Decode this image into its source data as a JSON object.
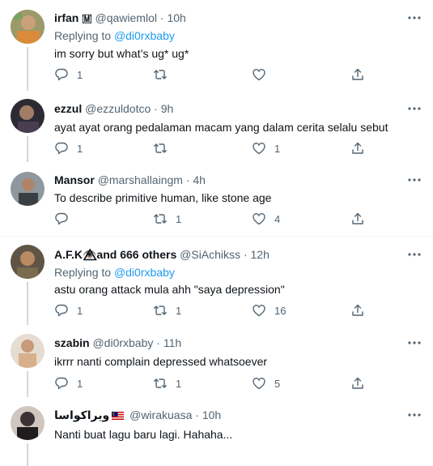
{
  "tweets": [
    {
      "name": "irfan 🇲",
      "handle": "@qawiemlol",
      "sep": "·",
      "time": "10h",
      "reply_prefix": "Replying to ",
      "reply_to": "@di0rxbaby",
      "text": "im sorry but what’s ug* ug*",
      "replies": "1",
      "retweets": "",
      "likes": "",
      "avatar_color": "#8a8a5a"
    },
    {
      "name": "ezzul",
      "handle": "@ezzuldotco",
      "sep": "·",
      "time": "9h",
      "text": "ayat ayat orang pedalaman macam yang dalam cerita selalu sebut",
      "replies": "1",
      "retweets": "",
      "likes": "1",
      "avatar_color": "#3b2f3a"
    },
    {
      "name": "Mansor",
      "handle": "@marshallaingm",
      "sep": "·",
      "time": "4h",
      "text": "To describe primitive human, like stone age",
      "replies": "",
      "retweets": "1",
      "likes": "4",
      "avatar_color": "#6f7a80"
    },
    {
      "name": "A.F.K👁️⃤and 666 others",
      "handle": "@SiAchikss",
      "sep": "·",
      "time": "12h",
      "reply_prefix": "Replying to ",
      "reply_to": "@di0rxbaby",
      "text": "astu orang attack mula ahh \"saya depression\"",
      "replies": "1",
      "retweets": "1",
      "likes": "16",
      "avatar_color": "#7d6a52"
    },
    {
      "name": "szabin",
      "handle": "@di0rxbaby",
      "sep": "·",
      "time": "11h",
      "text": "ikrrr nanti complain depressed whatsoever",
      "replies": "1",
      "retweets": "1",
      "likes": "5",
      "avatar_color": "#c9a88a"
    },
    {
      "name": "ويراكواسا",
      "handle": "@wirakuasa",
      "sep": "·",
      "time": "10h",
      "text": "Nanti buat lagu baru lagi. Hahaha...",
      "avatar_color": "#2c2a2b"
    }
  ],
  "icons": {
    "reply": "reply-icon",
    "retweet": "retweet-icon",
    "like": "heart-icon",
    "share": "share-icon",
    "more": "more-icon"
  },
  "colors": {
    "link": "#1d9bf0",
    "secondary": "#536471",
    "thread_line": "#cfd9de"
  }
}
